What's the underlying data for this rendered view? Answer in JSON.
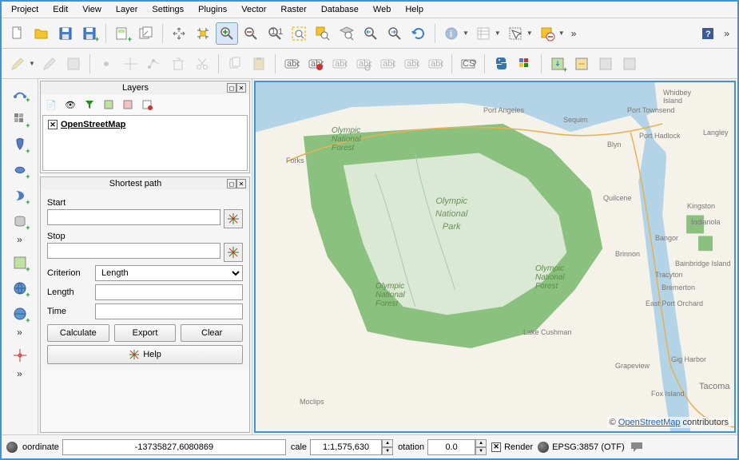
{
  "menu": [
    "Project",
    "Edit",
    "View",
    "Layer",
    "Settings",
    "Plugins",
    "Vector",
    "Raster",
    "Database",
    "Web",
    "Help"
  ],
  "panels": {
    "layers": {
      "title": "Layers",
      "items": [
        {
          "name": "OpenStreetMap",
          "checked": true
        }
      ]
    },
    "shortest_path": {
      "title": "Shortest path",
      "start_label": "Start",
      "start_value": "",
      "stop_label": "Stop",
      "stop_value": "",
      "criterion_label": "Criterion",
      "criterion_value": "Length",
      "length_label": "Length",
      "length_value": "",
      "time_label": "Time",
      "time_value": "",
      "calculate": "Calculate",
      "export": "Export",
      "clear": "Clear",
      "help": "Help"
    }
  },
  "map": {
    "credit_prefix": "© ",
    "credit_link": "OpenStreetMap",
    "credit_suffix": " contributors",
    "labels": {
      "center_park": "Olympic\nNational\nPark",
      "onf_nw": "Olympic\nNational\nForest",
      "onf_s": "Olympic\nNational\nForest",
      "onf_e": "Olympic\nNational\nForest",
      "port_angeles": "Port Angeles",
      "sequim": "Sequim",
      "port_townsend": "Port Townsend",
      "whidbey": "Whidbey\nIsland",
      "langley": "Langley",
      "port_hadlock": "Port Hadlock",
      "blyn": "Blyn",
      "forks": "Forks",
      "quilcene": "Quilcene",
      "kingston": "Kingston",
      "indianola": "Indianola",
      "bangor": "Bangor",
      "brinnon": "Brinnon",
      "bainbridge": "Bainbridge Island",
      "tracyton": "Tracyton",
      "bremerton": "Bremerton",
      "east_port_orchard": "East Port Orchard",
      "lake_cushman": "Lake Cushman",
      "gig_harbor": "Gig Harbor",
      "tacoma": "Tacoma",
      "fox_island": "Fox Island",
      "grapeview": "Grapeview",
      "moclips": "Moclips"
    }
  },
  "statusbar": {
    "coord_label": "oordinate",
    "coord_value": "-13735827,6080869",
    "scale_label": "cale",
    "scale_value": "1:1,575,630",
    "rotation_label": "otation",
    "rotation_value": "0.0",
    "render_label": "Render",
    "render_checked": true,
    "crs": "EPSG:3857 (OTF)"
  },
  "colors": {
    "accent": "#3a94e0",
    "forest": "#8bc17e",
    "park_fill": "#dbe8d3",
    "water": "#b3d4e6"
  }
}
